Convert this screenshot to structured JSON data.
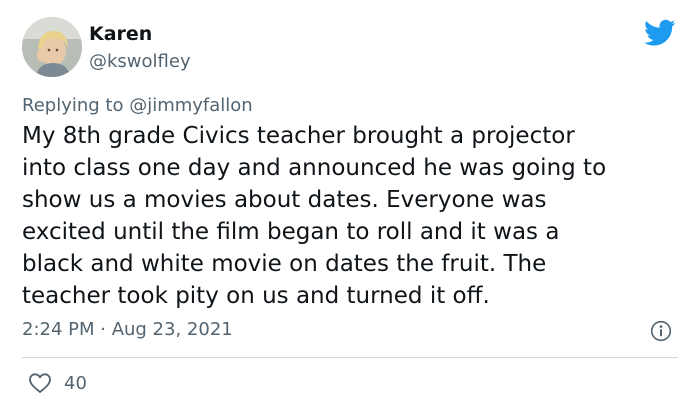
{
  "author": {
    "display_name": "Karen",
    "handle": "@kswolfley"
  },
  "reply": {
    "prefix": "Replying to ",
    "mention": "@jimmyfallon"
  },
  "body_lines": [
    "My 8th grade Civics teacher brought a projector",
    "into class one day and announced he was going to",
    "show us a movies about dates. Everyone was",
    "excited until the film began to roll and it was a",
    "black and white movie on dates the fruit. The",
    "teacher took pity on us and turned it off."
  ],
  "meta": {
    "timestamp": "2:24 PM · Aug 23, 2021"
  },
  "engagement": {
    "likes": "40"
  },
  "icons": {
    "logo": "twitter-bird-icon",
    "info": "info-icon",
    "like": "heart-icon"
  },
  "colors": {
    "brand": "#1d9bf0",
    "text": "#0f1419",
    "secondary": "#536471",
    "divider": "#cfd9de"
  }
}
